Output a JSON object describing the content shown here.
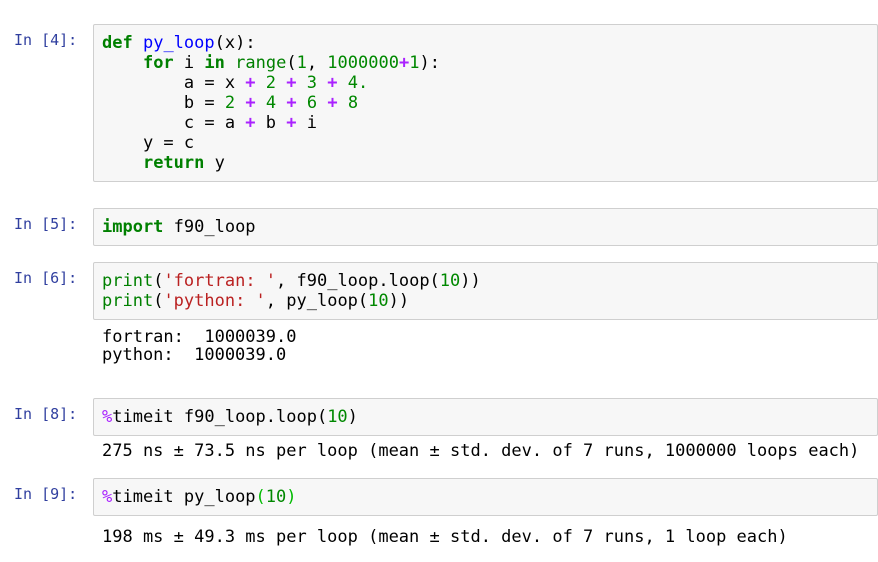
{
  "app": "jupyter-notebook",
  "colors": {
    "prompt": "#303F9F",
    "keyword": "#008000",
    "builtin": "#008000",
    "function_def": "#0000FF",
    "number": "#008800",
    "operator": "#AA22FF",
    "string": "#BA2121",
    "magic": "#AA22FF",
    "matched_bracket": "#00BB00",
    "cell_background": "#F7F7F7",
    "cell_border": "#CFCFCF"
  },
  "cells": [
    {
      "prompt": "In [4]:",
      "code": [
        [
          {
            "t": "def",
            "c": "kw"
          },
          {
            "t": " ",
            "c": "pl"
          },
          {
            "t": "py_loop",
            "c": "def"
          },
          {
            "t": "(x):",
            "c": "pl"
          }
        ],
        [
          {
            "t": "    ",
            "c": "pl"
          },
          {
            "t": "for",
            "c": "kw"
          },
          {
            "t": " i ",
            "c": "pl"
          },
          {
            "t": "in",
            "c": "kw"
          },
          {
            "t": " ",
            "c": "pl"
          },
          {
            "t": "range",
            "c": "bi"
          },
          {
            "t": "(",
            "c": "pl"
          },
          {
            "t": "1",
            "c": "num"
          },
          {
            "t": ", ",
            "c": "pl"
          },
          {
            "t": "1000000",
            "c": "num"
          },
          {
            "t": "+",
            "c": "op"
          },
          {
            "t": "1",
            "c": "num"
          },
          {
            "t": "):",
            "c": "pl"
          }
        ],
        [
          {
            "t": "        a = x ",
            "c": "pl"
          },
          {
            "t": "+",
            "c": "op"
          },
          {
            "t": " ",
            "c": "pl"
          },
          {
            "t": "2",
            "c": "num"
          },
          {
            "t": " ",
            "c": "pl"
          },
          {
            "t": "+",
            "c": "op"
          },
          {
            "t": " ",
            "c": "pl"
          },
          {
            "t": "3",
            "c": "num"
          },
          {
            "t": " ",
            "c": "pl"
          },
          {
            "t": "+",
            "c": "op"
          },
          {
            "t": " ",
            "c": "pl"
          },
          {
            "t": "4.",
            "c": "num"
          }
        ],
        [
          {
            "t": "        b = ",
            "c": "pl"
          },
          {
            "t": "2",
            "c": "num"
          },
          {
            "t": " ",
            "c": "pl"
          },
          {
            "t": "+",
            "c": "op"
          },
          {
            "t": " ",
            "c": "pl"
          },
          {
            "t": "4",
            "c": "num"
          },
          {
            "t": " ",
            "c": "pl"
          },
          {
            "t": "+",
            "c": "op"
          },
          {
            "t": " ",
            "c": "pl"
          },
          {
            "t": "6",
            "c": "num"
          },
          {
            "t": " ",
            "c": "pl"
          },
          {
            "t": "+",
            "c": "op"
          },
          {
            "t": " ",
            "c": "pl"
          },
          {
            "t": "8",
            "c": "num"
          }
        ],
        [
          {
            "t": "        c = a ",
            "c": "pl"
          },
          {
            "t": "+",
            "c": "op"
          },
          {
            "t": " b ",
            "c": "pl"
          },
          {
            "t": "+",
            "c": "op"
          },
          {
            "t": " i",
            "c": "pl"
          }
        ],
        [
          {
            "t": "    y = c",
            "c": "pl"
          }
        ],
        [
          {
            "t": "    ",
            "c": "pl"
          },
          {
            "t": "return",
            "c": "kw"
          },
          {
            "t": " y",
            "c": "pl"
          }
        ]
      ],
      "output": []
    },
    {
      "prompt": "In [5]:",
      "code": [
        [
          {
            "t": "import",
            "c": "kw"
          },
          {
            "t": " f90_loop",
            "c": "pl"
          }
        ]
      ],
      "output": []
    },
    {
      "prompt": "In [6]:",
      "code": [
        [
          {
            "t": "print",
            "c": "bi"
          },
          {
            "t": "(",
            "c": "pl"
          },
          {
            "t": "'fortran: '",
            "c": "str"
          },
          {
            "t": ", f90_loop.loop(",
            "c": "pl"
          },
          {
            "t": "10",
            "c": "num"
          },
          {
            "t": "))",
            "c": "pl"
          }
        ],
        [
          {
            "t": "print",
            "c": "bi"
          },
          {
            "t": "(",
            "c": "pl"
          },
          {
            "t": "'python: '",
            "c": "str"
          },
          {
            "t": ", py_loop(",
            "c": "pl"
          },
          {
            "t": "10",
            "c": "num"
          },
          {
            "t": "))",
            "c": "pl"
          }
        ]
      ],
      "output": [
        "fortran:  1000039.0",
        "python:  1000039.0"
      ]
    },
    {
      "prompt": "In [8]:",
      "code": [
        [
          {
            "t": "%",
            "c": "mg"
          },
          {
            "t": "timeit f90_loop.loop(",
            "c": "pl"
          },
          {
            "t": "10",
            "c": "num"
          },
          {
            "t": ")",
            "c": "pl"
          }
        ]
      ],
      "output": [
        "275 ns ± 73.5 ns per loop (mean ± std. dev. of 7 runs, 1000000 loops each)"
      ]
    },
    {
      "prompt": "In [9]:",
      "code": [
        [
          {
            "t": "%",
            "c": "mg"
          },
          {
            "t": "timeit py_loop",
            "c": "pl"
          },
          {
            "t": "(",
            "c": "mb"
          },
          {
            "t": "10",
            "c": "num"
          },
          {
            "t": ")",
            "c": "mb"
          }
        ]
      ],
      "output": [
        "198 ms ± 49.3 ms per loop (mean ± std. dev. of 7 runs, 1 loop each)"
      ]
    }
  ]
}
